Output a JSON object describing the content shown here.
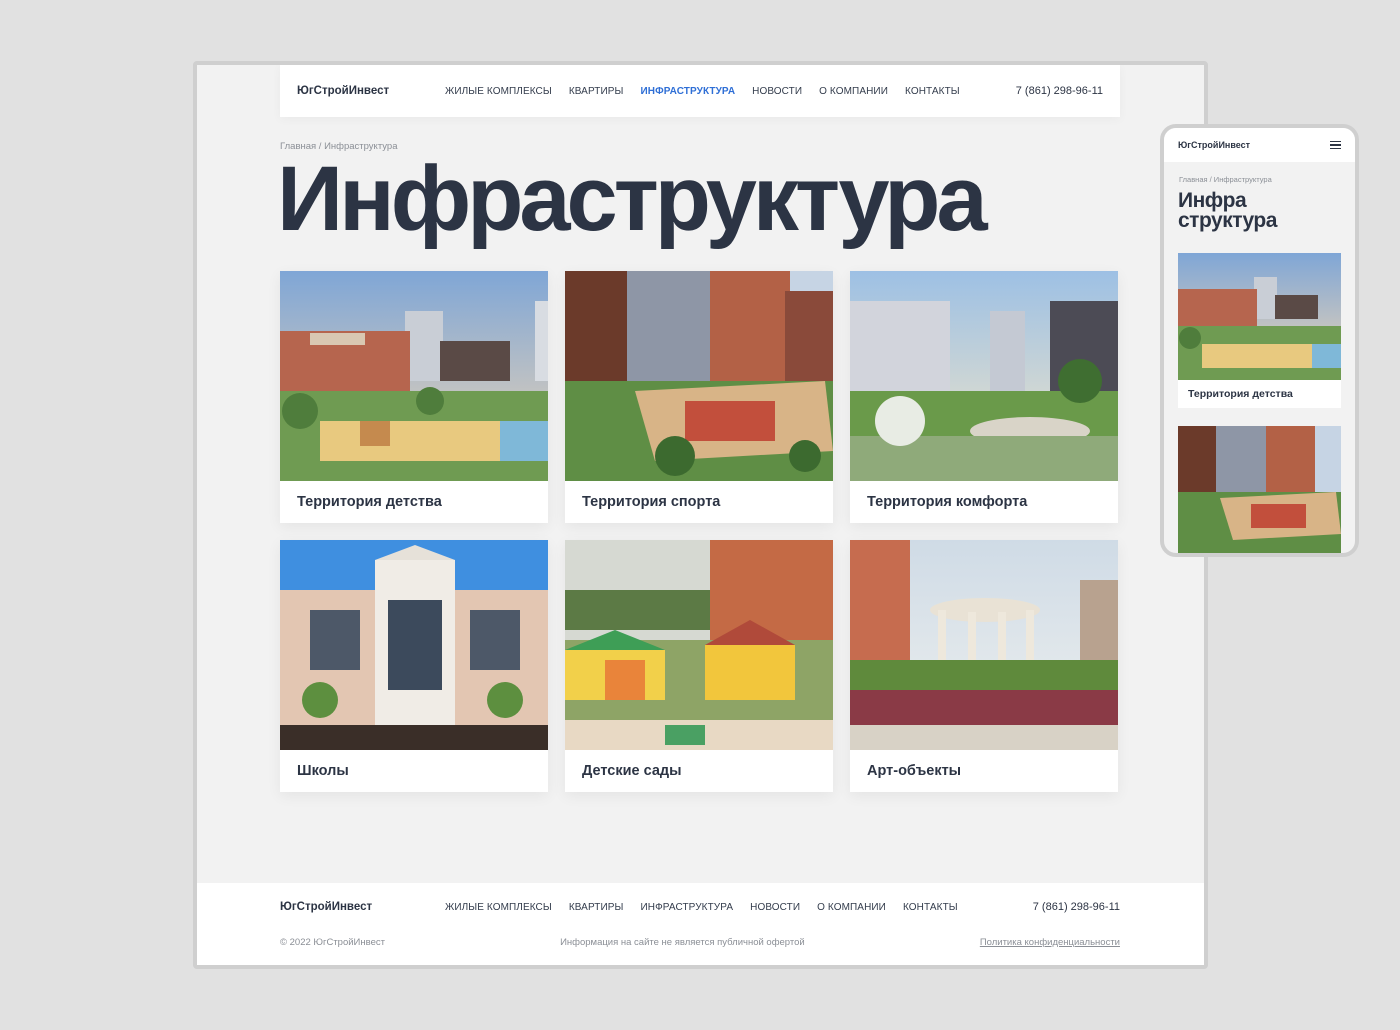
{
  "desktop": {
    "header": {
      "logo": "ЮгСтройИнвест",
      "nav": [
        "ЖИЛЫЕ КОМПЛЕКСЫ",
        "КВАРТИРЫ",
        "ИНФРАСТРУКТУРА",
        "НОВОСТИ",
        "О КОМПАНИИ",
        "КОНТАКТЫ"
      ],
      "active_nav": "ИНФРАСТРУКТУРА",
      "phone": "7 (861) 298-96-11"
    },
    "breadcrumb": "Главная / Инфраструктура",
    "title": "Инфраструктура",
    "cards": [
      {
        "label": "Территория детства"
      },
      {
        "label": "Территория спорта"
      },
      {
        "label": "Территория комфорта"
      },
      {
        "label": "Школы"
      },
      {
        "label": "Детские сады"
      },
      {
        "label": "Арт-объекты"
      }
    ],
    "footer": {
      "logo": "ЮгСтройИнвест",
      "nav": [
        "ЖИЛЫЕ КОМПЛЕКСЫ",
        "КВАРТИРЫ",
        "ИНФРАСТРУКТУРА",
        "НОВОСТИ",
        "О КОМПАНИИ",
        "КОНТАКТЫ"
      ],
      "phone": "7 (861) 298-96-11",
      "copyright": "© 2022 ЮгСтройИнвест",
      "disclaimer": "Информация на сайте не является публичной офертой",
      "policy": "Политика конфиденциальности"
    }
  },
  "mobile": {
    "logo": "ЮгСтройИнвест",
    "breadcrumb": "Главная / Инфраструктура",
    "title_line1": "Инфра",
    "title_line2": "структура",
    "card_label": "Территория детства"
  },
  "colors": {
    "accent": "#2f6fd6",
    "text": "#2c3444",
    "page_bg": "#e1e1e1",
    "frame_bg": "#f2f2f2"
  }
}
